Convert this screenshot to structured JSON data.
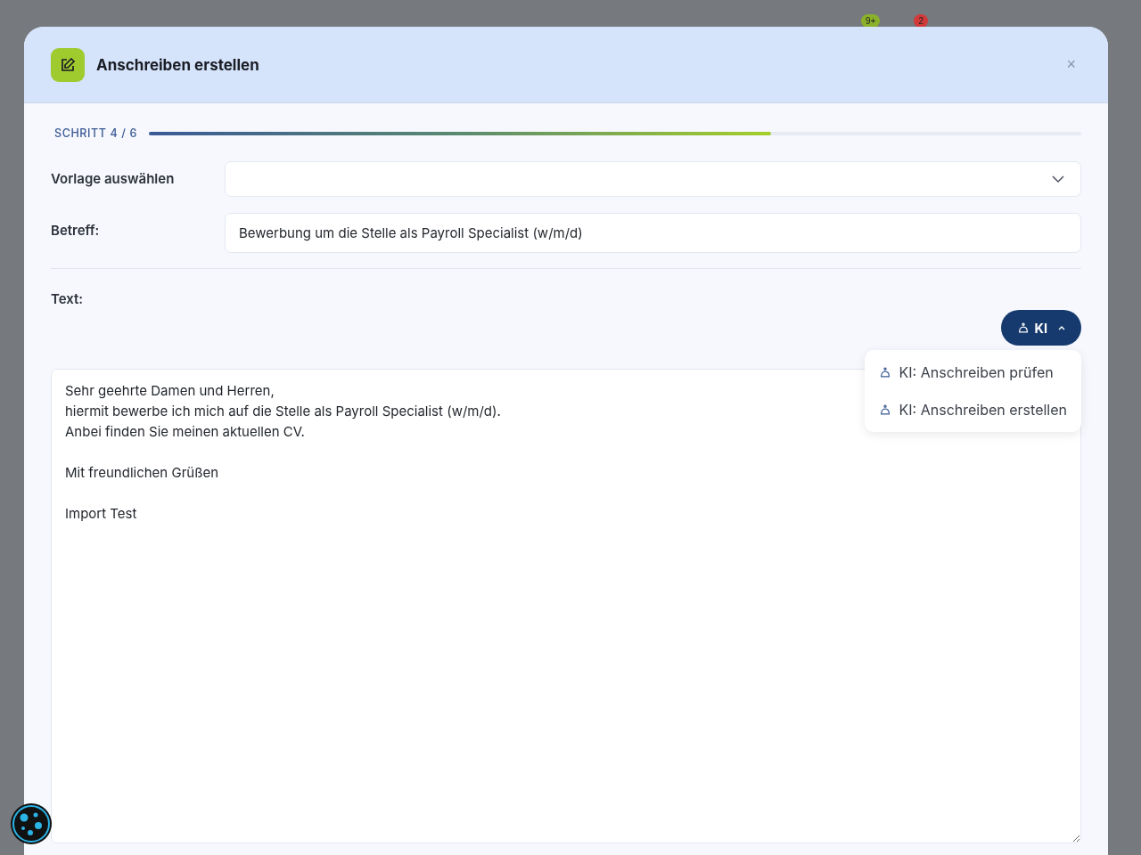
{
  "background": {
    "badges": [
      {
        "count": "9+",
        "color": "#8bb12a"
      },
      {
        "count": "2",
        "color": "#d23a3a"
      }
    ]
  },
  "dialog": {
    "title": "Anschreiben erstellen",
    "close": "×",
    "step": {
      "label": "SCHRITT 4 / 6",
      "level": 0.667
    },
    "template": {
      "label": "Vorlage auswählen"
    },
    "subject": {
      "label": "Betreff:",
      "value": "Bewerbung um die Stelle als Payroll Specialist (w/m/d)"
    },
    "text": {
      "label": "Text:",
      "value": "Sehr geehrte Damen und Herren,\nhiermit bewerbe ich mich auf die Stelle als Payroll Specialist (w/m/d).\nAnbei finden Sie meinen aktuellen CV.\n\nMit freundlichen Grüßen\n\nImport Test"
    },
    "ai_button": {
      "label": "KI",
      "expanded": true
    },
    "ai_menu": [
      {
        "label": "KI: Anschreiben prüfen"
      },
      {
        "label": "KI: Anschreiben erstellen"
      }
    ]
  }
}
